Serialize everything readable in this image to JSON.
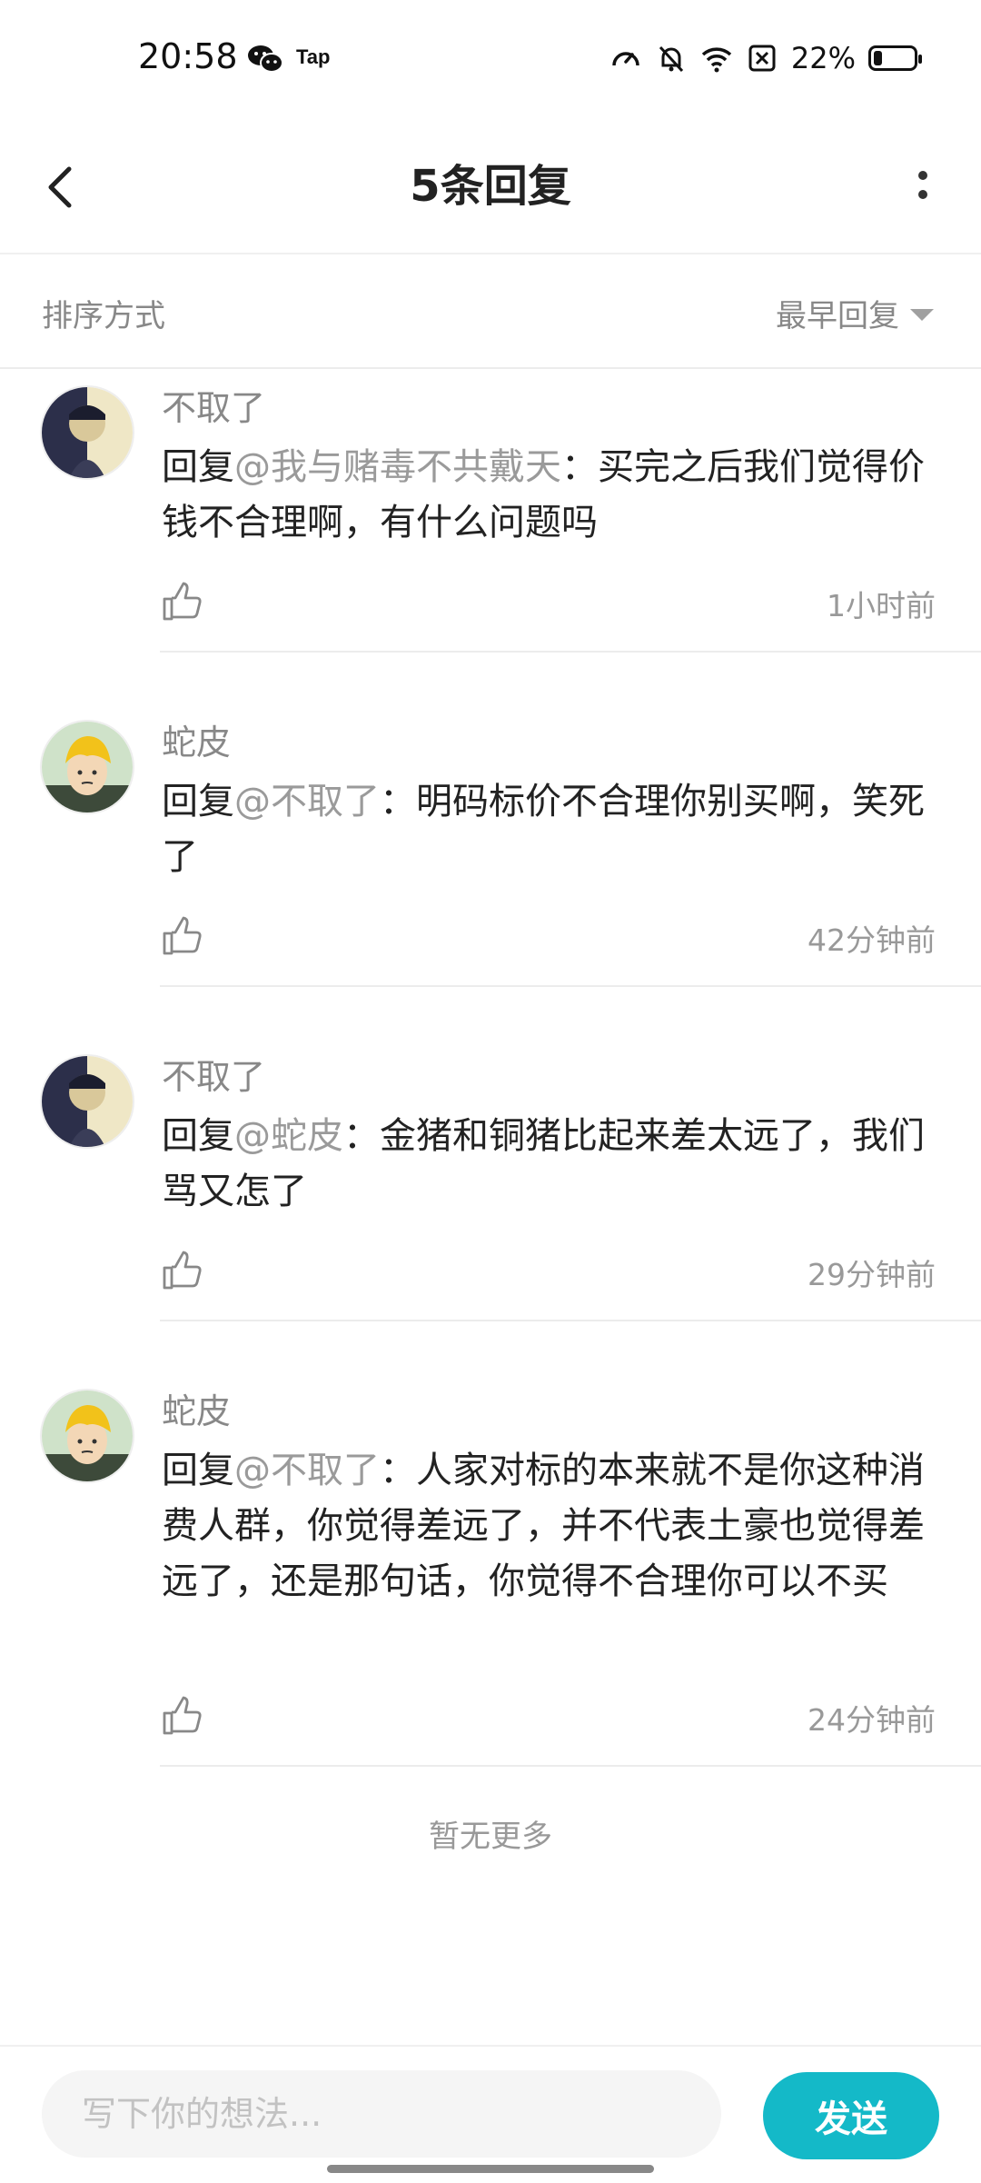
{
  "status_bar": {
    "time": "20:58",
    "app_badge": "Tap",
    "battery_percent": "22%",
    "battery_level": 0.22
  },
  "header": {
    "title": "5条回复"
  },
  "sort": {
    "label": "排序方式",
    "selected": "最早回复"
  },
  "comments": [
    {
      "author": "不取了",
      "reply_prefix": "回复",
      "mention": "@我与赌毒不共戴天",
      "separator": "：",
      "body": "买完之后我们觉得价钱不合理啊，有什么问题吗",
      "time": "1小时前",
      "avatar": "avatar-a"
    },
    {
      "author": "蛇皮",
      "reply_prefix": "回复",
      "mention": "@不取了",
      "separator": "：",
      "body": "明码标价不合理你别买啊，笑死了",
      "time": "42分钟前",
      "avatar": "avatar-b"
    },
    {
      "author": "不取了",
      "reply_prefix": "回复",
      "mention": "@蛇皮",
      "separator": "：",
      "body": "金猪和铜猪比起来差太远了，我们骂又怎了",
      "time": "29分钟前",
      "avatar": "avatar-a"
    },
    {
      "author": "蛇皮",
      "reply_prefix": "回复",
      "mention": "@不取了",
      "separator": "：",
      "body": "人家对标的本来就不是你这种消费人群，你觉得差远了，并不代表土豪也觉得差远了，还是那句话，你觉得不合理你可以不买",
      "time": "24分钟前",
      "avatar": "avatar-b"
    }
  ],
  "footer": {
    "no_more": "暂无更多"
  },
  "composer": {
    "placeholder": "写下你的想法...",
    "send_label": "发送"
  },
  "colors": {
    "accent": "#14b9c8",
    "muted_text": "#888888",
    "mention": "#9a9a9a"
  }
}
